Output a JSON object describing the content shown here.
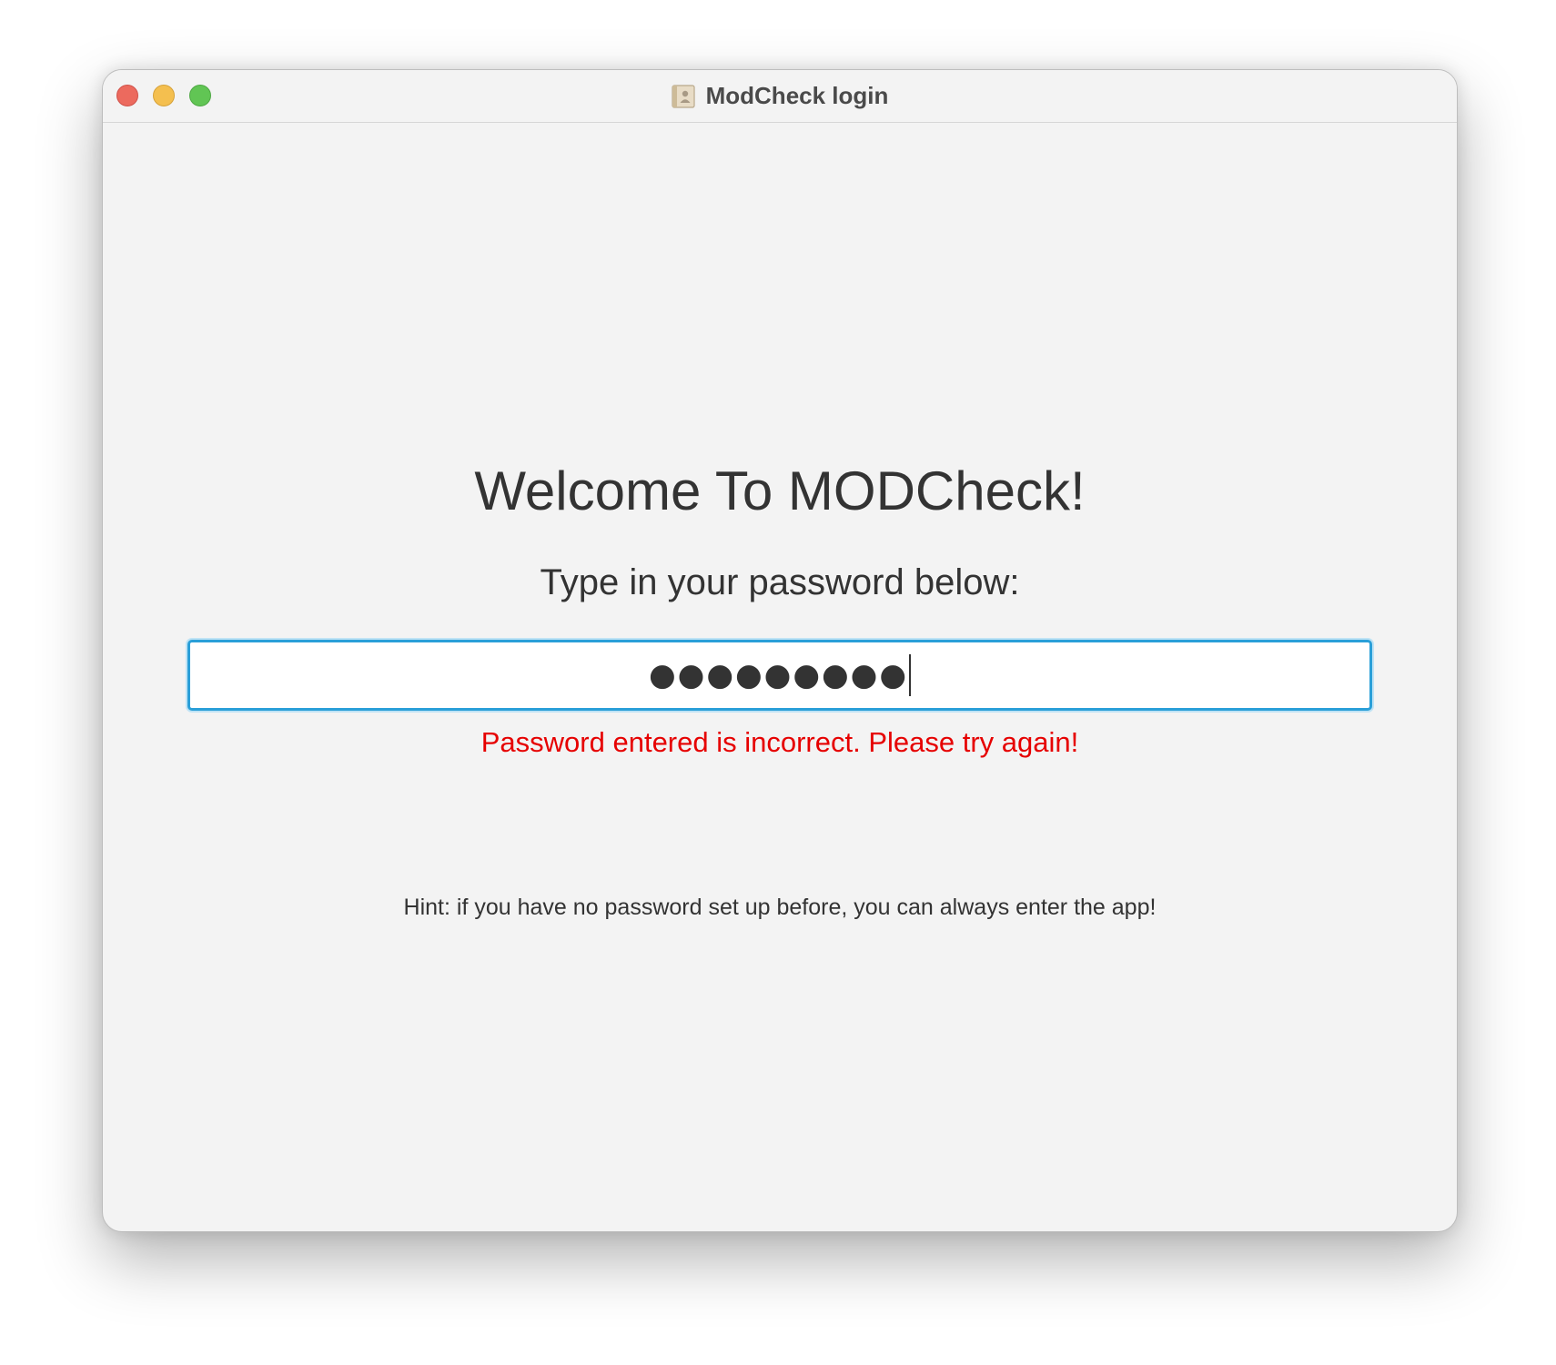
{
  "window": {
    "title": "ModCheck login",
    "icon": "contacts-book-icon"
  },
  "main": {
    "heading": "Welcome To MODCheck!",
    "instruction": "Type in your password below:",
    "password_field": {
      "value": "●●●●●●●●●",
      "focused": true
    },
    "error_message": "Password entered is incorrect. Please try again!",
    "hint": "Hint: if you have no password set up before, you can always enter the app!"
  },
  "colors": {
    "error": "#e60000",
    "focus_ring": "#2a9fd8",
    "background": "#f3f3f3",
    "text": "#333333"
  }
}
